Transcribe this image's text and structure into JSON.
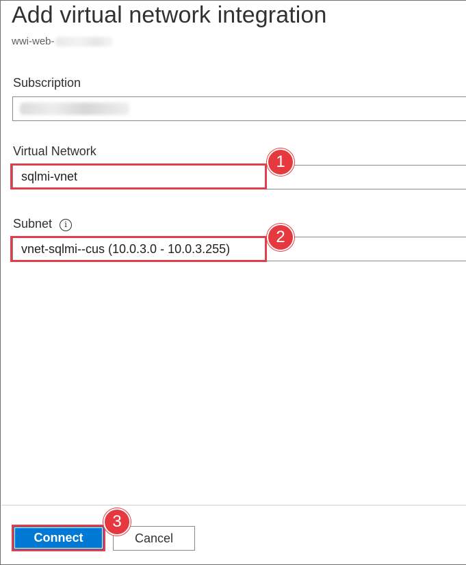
{
  "panel": {
    "title": "Add virtual network integration",
    "subtitle": "wwi-web-"
  },
  "form": {
    "subscription": {
      "label": "Subscription",
      "value": ""
    },
    "virtual_network": {
      "label": "Virtual Network",
      "value": "sqlmi-vnet"
    },
    "subnet": {
      "label": "Subnet",
      "value": "vnet-sqlmi--cus (10.0.3.0 - 10.0.3.255)",
      "info_icon": "info-icon"
    }
  },
  "callouts": {
    "step1": "1",
    "step2": "2",
    "step3": "3"
  },
  "footer": {
    "connect_label": "Connect",
    "cancel_label": "Cancel"
  },
  "colors": {
    "accent": "#0078d4",
    "callout": "#e5393f"
  }
}
